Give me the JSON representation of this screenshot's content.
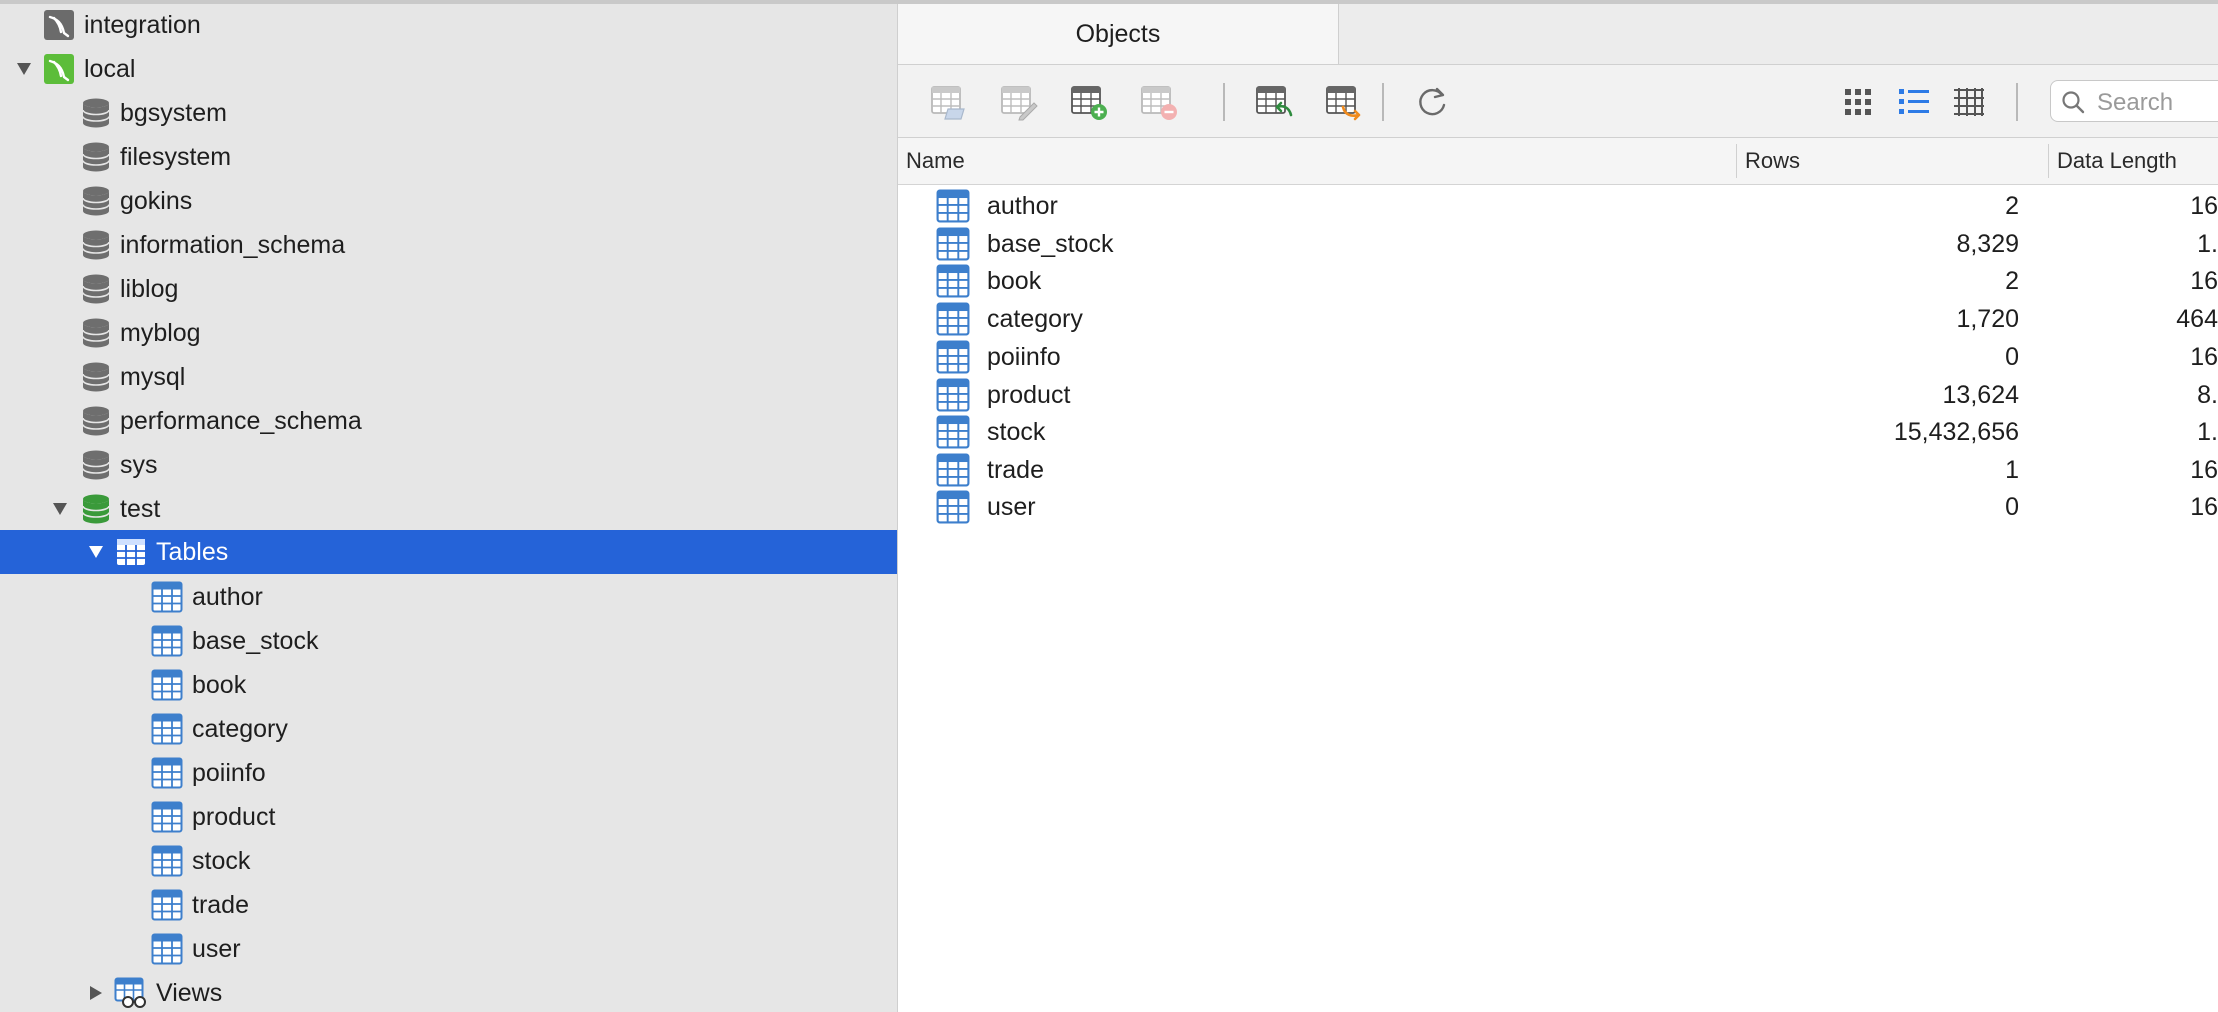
{
  "sidebar": {
    "connections": [
      {
        "label": "integration",
        "icon": "mysql-connection-gray-icon"
      },
      {
        "label": "local",
        "icon": "mysql-connection-green-icon",
        "expanded": true
      }
    ],
    "databases": [
      {
        "label": "bgsystem"
      },
      {
        "label": "filesystem"
      },
      {
        "label": "gokins"
      },
      {
        "label": "information_schema"
      },
      {
        "label": "liblog"
      },
      {
        "label": "myblog"
      },
      {
        "label": "mysql"
      },
      {
        "label": "performance_schema"
      },
      {
        "label": "sys"
      },
      {
        "label": "test",
        "expanded": true
      }
    ],
    "tables_node": {
      "label": "Tables",
      "selected": true
    },
    "tables": [
      {
        "label": "author"
      },
      {
        "label": "base_stock"
      },
      {
        "label": "book"
      },
      {
        "label": "category"
      },
      {
        "label": "poiinfo"
      },
      {
        "label": "product"
      },
      {
        "label": "stock"
      },
      {
        "label": "trade"
      },
      {
        "label": "user"
      }
    ],
    "views_node": {
      "label": "Views"
    }
  },
  "main": {
    "tab": {
      "label": "Objects"
    },
    "search": {
      "placeholder": "Search"
    },
    "columns": {
      "name": "Name",
      "rows": "Rows",
      "data_length": "Data Length"
    },
    "rows": [
      {
        "name": "author",
        "rows": "2",
        "data_length": "16"
      },
      {
        "name": "base_stock",
        "rows": "8,329",
        "data_length": "1."
      },
      {
        "name": "book",
        "rows": "2",
        "data_length": "16"
      },
      {
        "name": "category",
        "rows": "1,720",
        "data_length": "464"
      },
      {
        "name": "poiinfo",
        "rows": "0",
        "data_length": "16"
      },
      {
        "name": "product",
        "rows": "13,624",
        "data_length": "8."
      },
      {
        "name": "stock",
        "rows": "15,432,656",
        "data_length": "1."
      },
      {
        "name": "trade",
        "rows": "1",
        "data_length": "16"
      },
      {
        "name": "user",
        "rows": "0",
        "data_length": "16"
      }
    ]
  },
  "colors": {
    "selection": "#2563d8",
    "sidebar_bg": "#e6e6e6",
    "table_icon_blue": "#3d7fcc",
    "db_gray": "#6e6e6e",
    "db_green": "#3a9a3a"
  }
}
